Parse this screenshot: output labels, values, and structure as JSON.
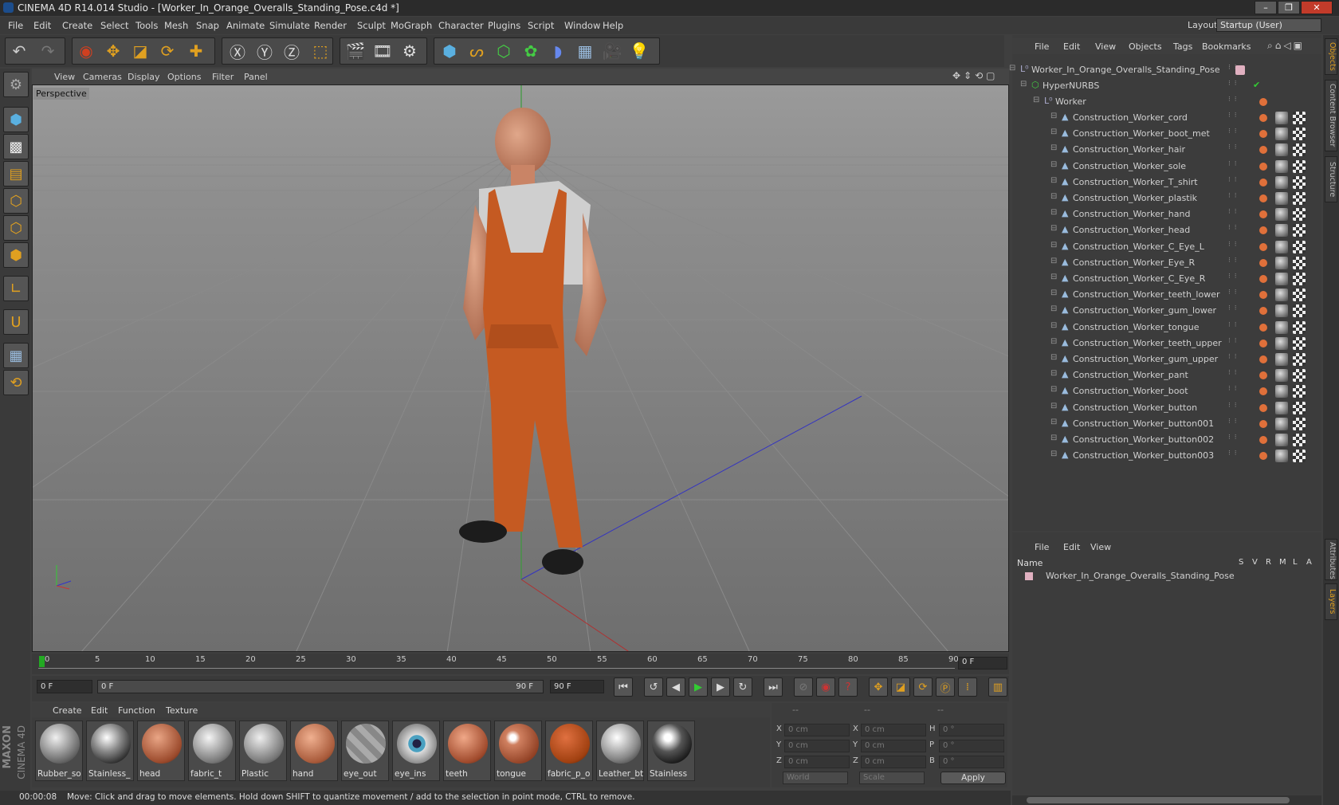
{
  "window": {
    "title": "CINEMA 4D R14.014 Studio - [Worker_In_Orange_Overalls_Standing_Pose.c4d *]"
  },
  "menu": [
    "File",
    "Edit",
    "Create",
    "Select",
    "Tools",
    "Mesh",
    "Snap",
    "Animate",
    "Simulate",
    "Render",
    "Sculpt",
    "MoGraph",
    "Character",
    "Plugins",
    "Script",
    "Window",
    "Help"
  ],
  "layout": {
    "label": "Layout:",
    "value": "Startup (User)"
  },
  "viewport": {
    "menu": [
      "View",
      "Cameras",
      "Display",
      "Options",
      "Filter",
      "Panel"
    ],
    "label": "Perspective"
  },
  "timeline": {
    "ticks": [
      "0",
      "5",
      "10",
      "15",
      "20",
      "25",
      "30",
      "35",
      "40",
      "45",
      "50",
      "55",
      "60",
      "65",
      "70",
      "75",
      "80",
      "85",
      "90"
    ],
    "current_frame": "0 F"
  },
  "transport": {
    "start": "0 F",
    "range_start": "0 F",
    "range_end": "90 F",
    "end": "90 F"
  },
  "material_manager": {
    "menu": [
      "Create",
      "Edit",
      "Function",
      "Texture"
    ],
    "materials": [
      "Rubber_so",
      "Stainless_",
      "head",
      "fabric_t",
      "Plastic",
      "hand",
      "eye_out",
      "eye_ins",
      "teeth",
      "tongue",
      "fabric_p_o",
      "Leather_bt",
      "Stainless"
    ]
  },
  "coordinates": {
    "headers": [
      "--",
      "--",
      "--"
    ],
    "rows": [
      {
        "a": "X",
        "av": "0 cm",
        "b": "X",
        "bv": "0 cm",
        "c": "H",
        "cv": "0 °"
      },
      {
        "a": "Y",
        "av": "0 cm",
        "b": "Y",
        "bv": "0 cm",
        "c": "P",
        "cv": "0 °"
      },
      {
        "a": "Z",
        "av": "0 cm",
        "b": "Z",
        "bv": "0 cm",
        "c": "B",
        "cv": "0 °"
      }
    ],
    "mode1": "World",
    "mode2": "Scale",
    "apply": "Apply"
  },
  "status": {
    "time": "00:00:08",
    "message": "Move: Click and drag to move elements. Hold down SHIFT to quantize movement / add to the selection in point mode, CTRL to remove."
  },
  "object_manager": {
    "menu": [
      "File",
      "Edit",
      "View",
      "Objects",
      "Tags",
      "Bookmarks"
    ],
    "root": "Worker_In_Orange_Overalls_Standing_Pose",
    "hypernurbs": "HyperNURBS",
    "group": "Worker",
    "objects": [
      "Construction_Worker_cord",
      "Construction_Worker_boot_met",
      "Construction_Worker_hair",
      "Construction_Worker_sole",
      "Construction_Worker_T_shirt",
      "Construction_Worker_plastik",
      "Construction_Worker_hand",
      "Construction_Worker_head",
      "Construction_Worker_C_Eye_L",
      "Construction_Worker_Eye_R",
      "Construction_Worker_C_Eye_R",
      "Construction_Worker_teeth_lower",
      "Construction_Worker_gum_lower",
      "Construction_Worker_tongue",
      "Construction_Worker_teeth_upper",
      "Construction_Worker_gum_upper",
      "Construction_Worker_pant",
      "Construction_Worker_boot",
      "Construction_Worker_button",
      "Construction_Worker_button001",
      "Construction_Worker_button002",
      "Construction_Worker_button003"
    ]
  },
  "layer_manager": {
    "menu": [
      "File",
      "Edit",
      "View"
    ],
    "col_name": "Name",
    "cols": [
      "S",
      "V",
      "R",
      "M",
      "L",
      "A"
    ],
    "layer": "Worker_In_Orange_Overalls_Standing_Pose"
  },
  "side_tabs": [
    "Objects",
    "Content Browser",
    "Structure",
    "Attributes",
    "Layers"
  ],
  "brand": {
    "line1": "MAXON",
    "line2": "CINEMA 4D"
  }
}
